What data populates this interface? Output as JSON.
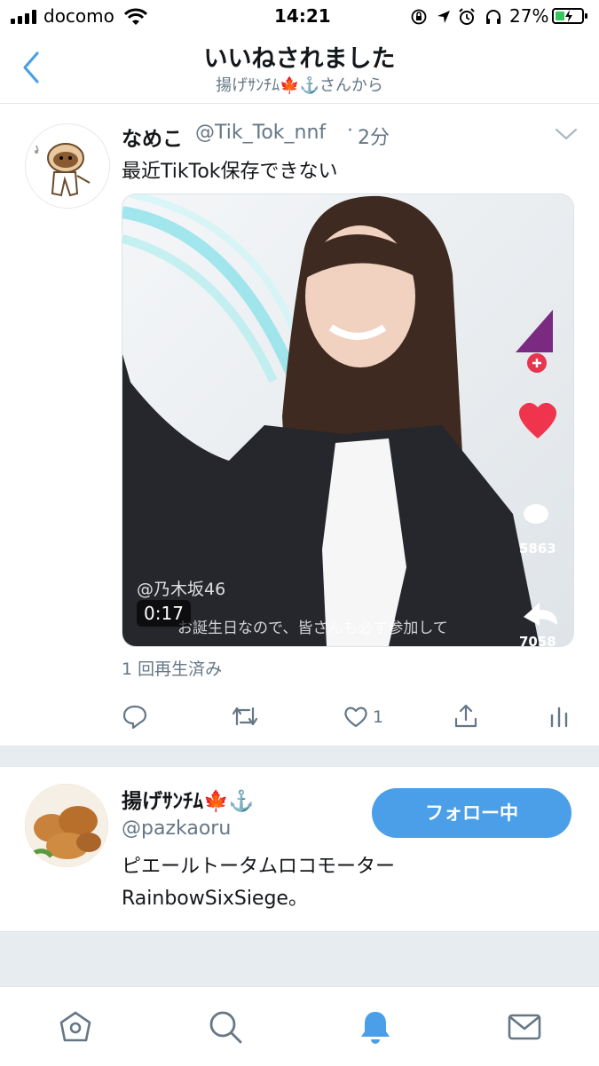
{
  "status_bar": {
    "carrier": "docomo",
    "time": "14:21",
    "battery": "27%"
  },
  "header": {
    "title": "いいねされました",
    "subtitle": "揚げｻﾝﾁﾑ🍁⚓️さんから"
  },
  "tweet": {
    "name": "なめこ",
    "handle": "@Tik_Tok_nnf",
    "dot": "·",
    "time": "2分",
    "text": "最近TikTok保存できない",
    "media": {
      "duration": "0:17",
      "tiktok_user": "@乃木坂46",
      "caption": "お誕生日なので、皆さんも必ず参加して",
      "comment_count": "5863",
      "share_count": "7058"
    },
    "view_count": "1 回再生済み",
    "like_count": "1"
  },
  "user_card": {
    "name": "揚げｻﾝﾁﾑ🍁⚓️",
    "handle": "@pazkaoru",
    "bio_line1": "ピエールトータムロコモーター",
    "bio_line2": "RainbowSixSiege。",
    "follow_label": "フォロー中"
  },
  "colors": {
    "accent": "#4a9fe8",
    "secondary_text": "#657786",
    "like_red": "#f0344d"
  },
  "icons": [
    "back-chevron-icon",
    "reply-icon",
    "retweet-icon",
    "like-icon",
    "share-icon",
    "analytics-icon",
    "home-icon",
    "search-icon",
    "notifications-icon",
    "messages-icon"
  ]
}
